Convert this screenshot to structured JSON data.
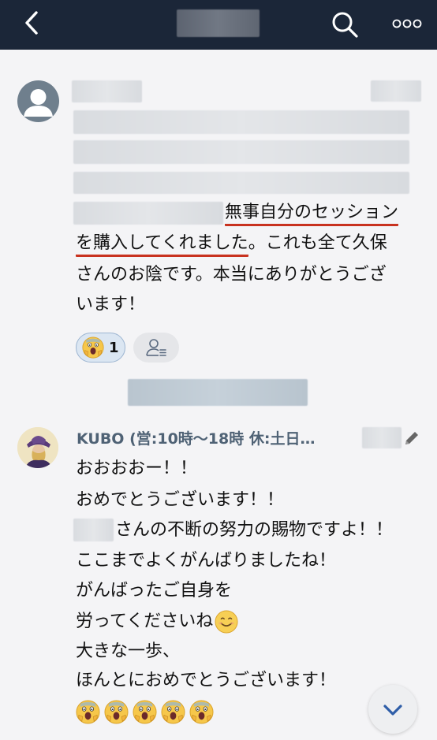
{
  "header": {
    "back_icon": "chevron-left-icon",
    "search_icon": "search-icon",
    "more_icon": "more-horizontal-icon",
    "background_color": "#1b2638"
  },
  "message1": {
    "avatar_icon": "default-user-avatar-icon",
    "lines": [
      "無事自分のセッション",
      "を購入してくれました",
      "。これも全て久保",
      "さんのお陰です。本当にありがとうござ",
      "います！"
    ],
    "underline_color": "#c8321f",
    "reaction": {
      "emoji": "screaming-face-emoji",
      "count": "1"
    },
    "add_reaction_icon": "user-reaction-list-icon"
  },
  "message2": {
    "sender_name": "KUBO (営:10時〜18時 休:土日…",
    "lines": [
      "おおおおー！！",
      "おめでとうございます！！",
      "さんの不断の努力の賜物ですよ！！",
      "ここまでよくがんばりましたね！",
      "がんばったご自身を",
      "労ってくださいね",
      "大きな一歩、",
      "ほんとにおめでとうございます！"
    ],
    "inline_emoji": "smiling-face-emoji",
    "edit_icon": "pencil-icon",
    "emoji_row": [
      "screaming-face-emoji",
      "screaming-face-emoji",
      "screaming-face-emoji",
      "screaming-face-emoji",
      "screaming-face-emoji"
    ]
  },
  "scroll_down_icon": "chevron-down-icon"
}
